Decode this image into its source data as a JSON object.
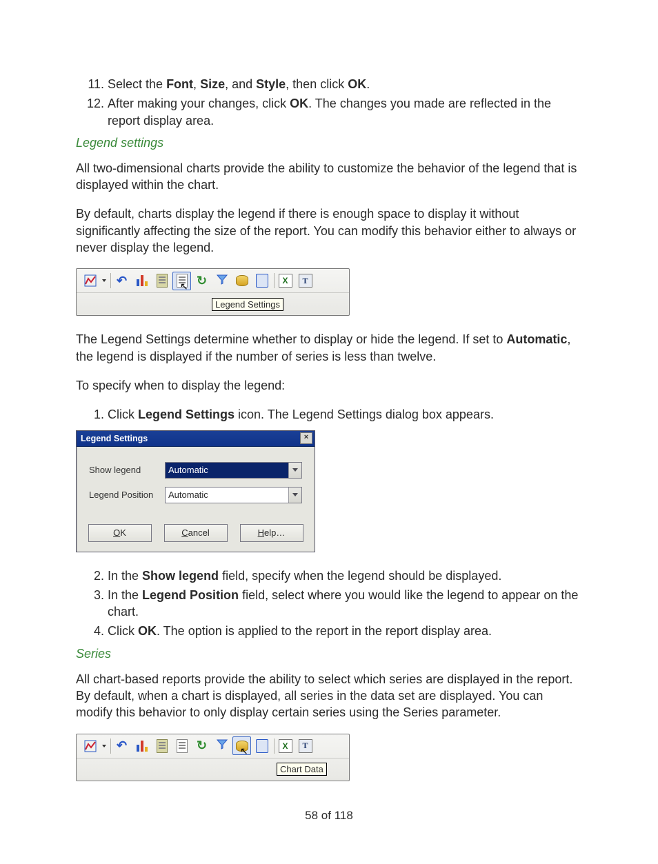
{
  "step11": {
    "prefix": "Select the ",
    "font": "Font",
    "comma1": ", ",
    "size": "Size",
    "comma2": ", and ",
    "style": "Style",
    "mid": ", then click ",
    "ok": "OK",
    "suffix": "."
  },
  "step12": {
    "prefix": "After making your changes, click ",
    "ok": "OK",
    "suffix": ". The changes you made are reflected in the report display area."
  },
  "h3_legend": "Legend settings",
  "para_legend_1": "All two-dimensional charts provide the ability to customize the behavior of the legend that is displayed within the chart.",
  "para_legend_2": "By default, charts display the legend if there is enough space to display it without significantly affecting the size of the report. You can modify this behavior either to always or never display the legend.",
  "toolbar1": {
    "tooltip": "Legend Settings"
  },
  "para_legend_3a": "The Legend Settings determine whether to display or hide the legend. If set to ",
  "para_legend_3_bold": "Automatic",
  "para_legend_3b": ", the legend is displayed if the number of series is less than twelve.",
  "para_legend_4": "To specify when to display the legend:",
  "legend_steps": {
    "s1a": "Click ",
    "s1_bold": "Legend Settings",
    "s1b": " icon. The Legend Settings dialog box appears."
  },
  "dialog": {
    "title": "Legend Settings",
    "close": "×",
    "label_show": "Show legend",
    "value_show": "Automatic",
    "label_pos": "Legend Position",
    "value_pos": "Automatic",
    "btn_ok_u": "O",
    "btn_ok_r": "K",
    "btn_cancel_u": "C",
    "btn_cancel_r": "ancel",
    "btn_help_u": "H",
    "btn_help_r": "elp…"
  },
  "legend_steps2": {
    "s2a": "In the ",
    "s2_bold": "Show legend",
    "s2b": " field, specify when the legend should be displayed.",
    "s3a": "In the ",
    "s3_bold": "Legend Position",
    "s3b": " field, select where you would like the legend to appear on the chart.",
    "s4a": "Click ",
    "s4_bold": "OK",
    "s4b": ". The option is applied to the report in the report display area."
  },
  "h3_series": "Series",
  "para_series_1": "All chart-based reports provide the ability to select which series are displayed in the report. By default, when a chart is displayed, all series in the data set are displayed. You can modify this behavior to only display certain series using the Series parameter.",
  "toolbar2": {
    "tooltip": "Chart Data"
  },
  "footer": "58 of 118"
}
